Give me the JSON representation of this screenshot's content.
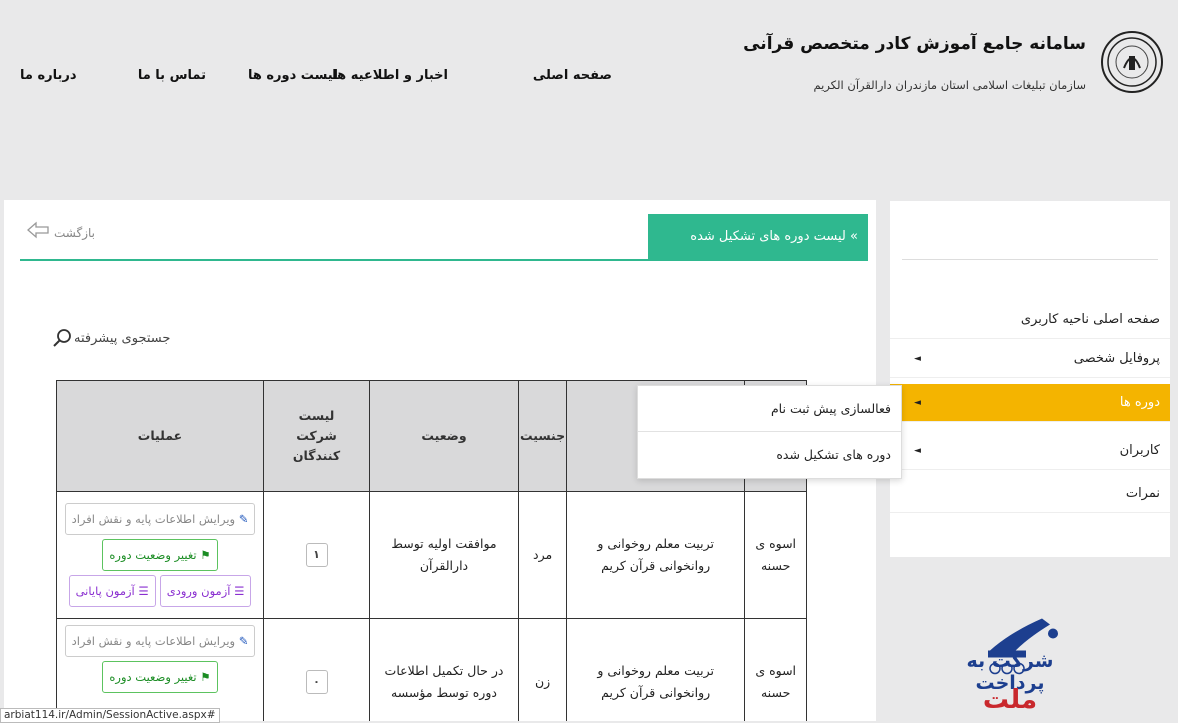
{
  "header": {
    "site_title": "سامانه جامع آموزش کادر متخصص قرآنی",
    "site_subtitle": "سازمان تبلیغات اسلامی استان مازندران دارالقرآن الکریم",
    "nav": {
      "home": "صفحه اصلی",
      "news": "اخبار و اطلاعیه ها",
      "courses": "لیست دوره ها",
      "contact": "تماس با ما",
      "about": "درباره ما"
    }
  },
  "main": {
    "page_title": "لیست دوره های تشکیل شده",
    "title_chevron": "»",
    "back_label": "بازگشت",
    "advanced_search": "جستجوی پیشرفته",
    "table": {
      "headers": {
        "operations": "عملیات",
        "participants": "لیست شرکت کنندگان",
        "status": "وضعیت",
        "gender": "جنسیت",
        "course": "ه"
      },
      "rows": [
        {
          "title": "اسوه ی حسنه",
          "course": "تربیت معلم روخوانی و روانخوانی قرآن کریم",
          "gender": "مرد",
          "status": "موافقت اولیه توسط دارالقرآن",
          "count": "۱",
          "ops": {
            "edit": "ویرایش اطلاعات پایه و نقش افراد",
            "change_status": "تغییر وضعیت دوره",
            "entry_exam": "آزمون ورودی",
            "final_exam": "آزمون پایانی"
          }
        },
        {
          "title": "اسوه ی حسنه",
          "course": "تربیت معلم روخوانی و روانخوانی قرآن کریم",
          "gender": "زن",
          "status": "در حال تکمیل اطلاعات دوره توسط مؤسسه",
          "count": "۰",
          "ops": {
            "edit": "ویرایش اطلاعات پایه و نقش افراد",
            "change_status": "تغییر وضعیت دوره"
          }
        }
      ]
    }
  },
  "sidebar": {
    "items": [
      {
        "label": "صفحه اصلی ناحیه کاربری",
        "arrow": ""
      },
      {
        "label": "پروفایل شخصی",
        "arrow": "◄"
      },
      {
        "label": "دوره ها",
        "arrow": "◄"
      },
      {
        "label": "کاربران",
        "arrow": "◄"
      },
      {
        "label": "نمرات",
        "arrow": ""
      }
    ]
  },
  "dropdown": {
    "items": [
      "فعالسازی پیش ثبت نام",
      "دوره های تشکیل شده"
    ]
  },
  "payment": {
    "line1": "شرکت به پرداخت",
    "line2": "ملت"
  },
  "statusbar": {
    "url": "arbiat114.ir/Admin/SessionActive.aspx#"
  },
  "colors": {
    "accent_green": "#2fb88f",
    "active_orange": "#f4b400",
    "status_green": "#1a8c23",
    "purple": "#8a2fd0"
  }
}
